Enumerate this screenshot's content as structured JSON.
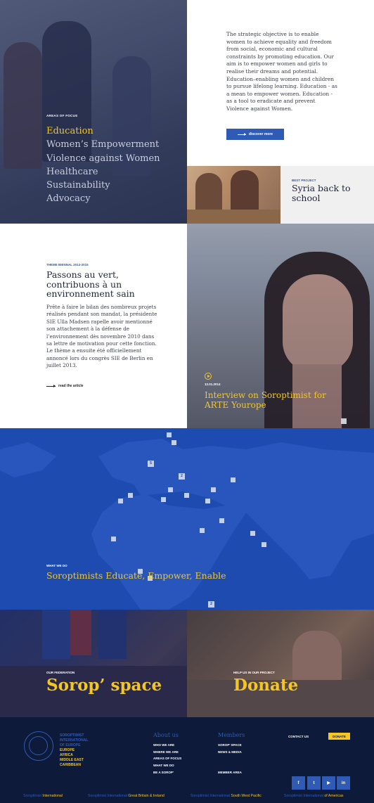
{
  "focus": {
    "label": "AREAS OF FOCUS",
    "items": [
      {
        "label": "Education",
        "active": true
      },
      {
        "label": "Women’s Empowerment",
        "active": false
      },
      {
        "label": "Violence against Women",
        "active": false
      },
      {
        "label": "Healthcare",
        "active": false
      },
      {
        "label": "Sustainability",
        "active": false
      },
      {
        "label": "Advocacy",
        "active": false
      }
    ]
  },
  "intro": {
    "text": "The strategic objective is to enable women to achieve equality and freedom from social, economic and cultural constraints by promoting education. Our aim is to empower women and girls to realise their dreams and potential.  Education–enabling women and children to pursue lifelong learning. Education - as a mean to empower women. Education - as a tool to eradicate and prevent Violence against Women.",
    "button": "discover more"
  },
  "project": {
    "tag": "BEST PROJECT",
    "title": "Syria back to school"
  },
  "theme": {
    "tag": "THEME BIENNAL 2013-2015",
    "title": "Passons au vert, contribuons à un environnement sain",
    "text": "Prête à faire le bilan des nombreux projets réalisés pendant son mandat, la présidente SIE Ulla Madsen rapelle avoir mentionné son attachement à la défense de l’environnement dès novembre 2010 dans sa lettre de motivation pour cette fonction. Le thème a ensuite été officiellement annoncé lors du congrès SIE de Berlin en juillet 2013.",
    "read": "read the article"
  },
  "video": {
    "date": "12.01.2014",
    "title": "Interview on Soroptimist for ARTE Yourope"
  },
  "map": {
    "tag": "WHAT WE DO",
    "title": "Soroptimists Educate, Empower, Enable",
    "pins": [
      "",
      "",
      "5",
      "2",
      "",
      "",
      "",
      "",
      "",
      "",
      "",
      "",
      "",
      "",
      "",
      "",
      "",
      "",
      "",
      "2"
    ]
  },
  "federation": {
    "tag": "OUR FEDERATION",
    "title": "Sorop’ space"
  },
  "donate": {
    "tag": "HELP US IN OUR PROJECT",
    "title": "Donate"
  },
  "footer": {
    "brand": [
      "SOROPTIMIST",
      "INTERNATIONAL",
      "OF EUROPE"
    ],
    "regions": [
      "EUROPE",
      "AFRICA",
      "MIDDLE EAST",
      "CARIBBEAN"
    ],
    "about": {
      "title": "About us",
      "links": [
        "WHO WE ARE",
        "WHERE WE ARE",
        "AREAS OF FOCUS",
        "WHAT WE DO",
        "BE A SOROP’"
      ]
    },
    "members": {
      "title": "Members",
      "links": [
        "SOROP’ SPACE",
        "NEWS & MEDIA",
        "",
        "",
        "MEMBER AREA"
      ]
    },
    "contact": "CONTACT US",
    "donate_button": "DONATE",
    "social": [
      "f",
      "t",
      "▶",
      "in"
    ],
    "bottom": [
      {
        "a": "Soroptimist ",
        "b": "International"
      },
      {
        "a": "Soroptimist International ",
        "b": "Great Britain & Ireland"
      },
      {
        "a": "Soroptimist International ",
        "b": "South West Pacific"
      },
      {
        "a": "Soroptimist International ",
        "b": "of Americas"
      }
    ]
  },
  "colors": {
    "accent": "#f3c623",
    "brand_blue": "#2f5bb7",
    "navy": "#0d1a3a",
    "map_blue": "#1d4bb0"
  }
}
